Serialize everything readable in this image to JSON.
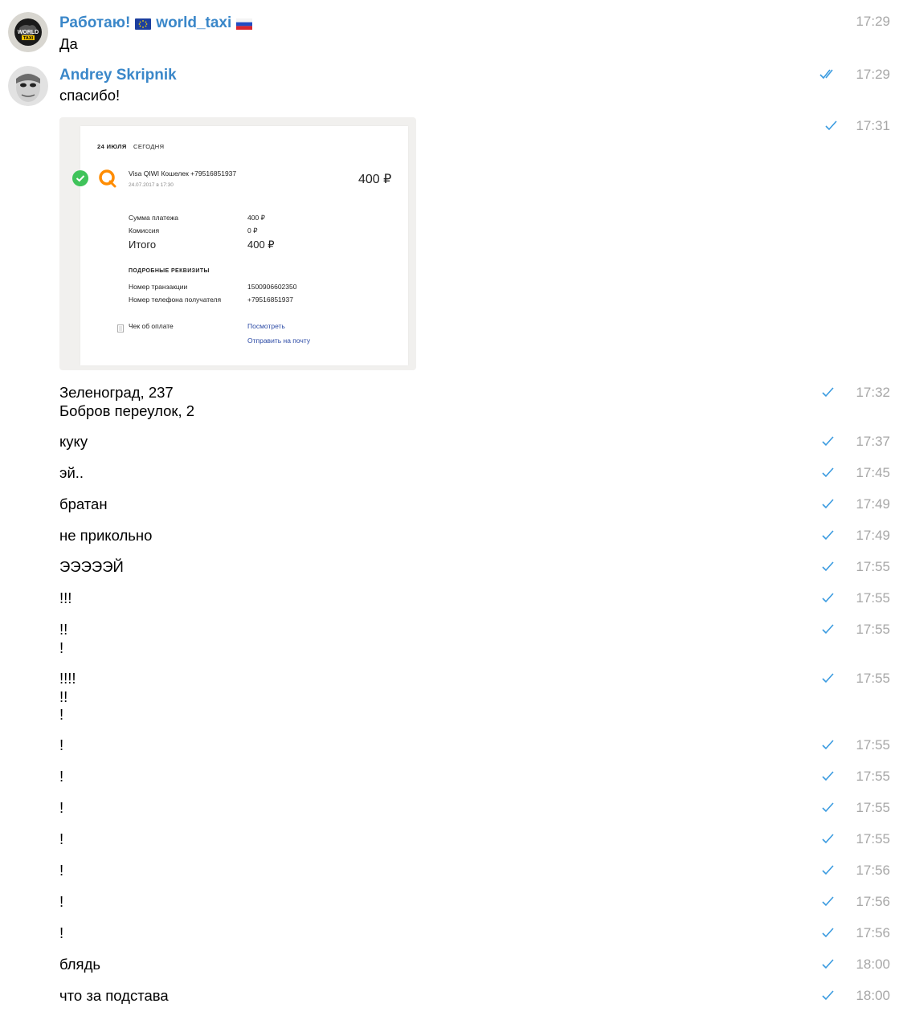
{
  "messages": {
    "first": {
      "sender_part1": "Работаю!",
      "sender_part2": "world_taxi",
      "text": "Да",
      "time": "17:29",
      "avatar_text": "WORLD TAXI"
    },
    "second": {
      "sender": "Andrey Skripnik",
      "text": "спасибо!",
      "time": "17:29"
    },
    "image": {
      "time": "17:31",
      "receipt": {
        "date": "24 ИЮЛЯ",
        "today": "СЕГОДНЯ",
        "title": "Visa QIWI Кошелек +79516851937",
        "datetime": "24.07.2017 в 17:30",
        "amount": "400 ₽",
        "rows": [
          {
            "label": "Сумма платежа",
            "value": "400 ₽"
          },
          {
            "label": "Комиссия",
            "value": "0 ₽"
          },
          {
            "label": "Итого",
            "value": "400 ₽"
          }
        ],
        "details_header": "ПОДРОБНЫЕ РЕКВИЗИТЫ",
        "details": [
          {
            "label": "Номер транзакции",
            "value": "1500906602350"
          },
          {
            "label": "Номер телефона получателя",
            "value": "+79516851937"
          }
        ],
        "check_label": "Чек об оплате",
        "view_link": "Посмотреть",
        "send_link": "Отправить на почту"
      }
    },
    "list": [
      {
        "text": "Зеленоград, 237\nБобров переулок, 2",
        "time": "17:32"
      },
      {
        "text": "куку",
        "time": "17:37"
      },
      {
        "text": "эй..",
        "time": "17:45"
      },
      {
        "text": "братан",
        "time": "17:49"
      },
      {
        "text": "не прикольно",
        "time": "17:49"
      },
      {
        "text": "ЭЭЭЭЭЙ",
        "time": "17:55"
      },
      {
        "text": "!!!",
        "time": "17:55"
      },
      {
        "text": "!!\n!",
        "time": "17:55"
      },
      {
        "text": "!!!!\n!!\n!",
        "time": "17:55"
      },
      {
        "text": "!",
        "time": "17:55"
      },
      {
        "text": "!",
        "time": "17:55"
      },
      {
        "text": "!",
        "time": "17:55"
      },
      {
        "text": "!",
        "time": "17:55"
      },
      {
        "text": "!",
        "time": "17:56"
      },
      {
        "text": "!",
        "time": "17:56"
      },
      {
        "text": "!",
        "time": "17:56"
      },
      {
        "text": "блядь",
        "time": "18:00"
      },
      {
        "text": "что за подстава",
        "time": "18:00"
      }
    ]
  },
  "colors": {
    "sender": "#3a87c9",
    "check": "#3a9be0",
    "time": "#a7a7a7"
  },
  "icons": {
    "read": "double-check-icon",
    "sent": "single-check-icon",
    "success": "green-check-circle-icon",
    "qiwi": "qiwi-logo-icon"
  }
}
